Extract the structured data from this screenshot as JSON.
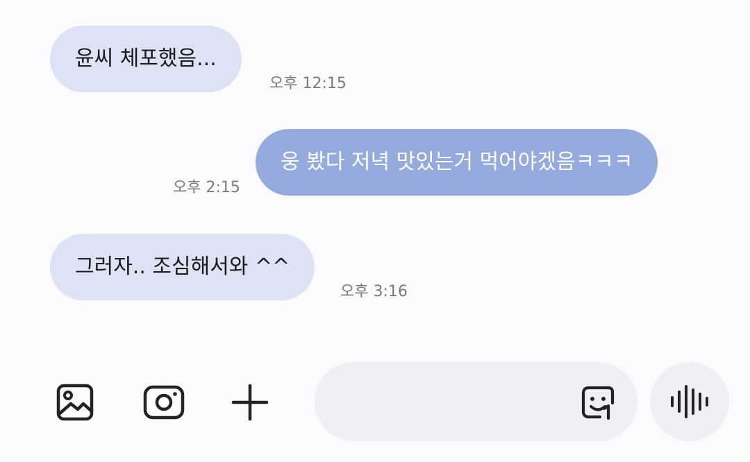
{
  "messages": [
    {
      "direction": "incoming",
      "text": "윤씨 체포했음...",
      "time": "오후 12:15"
    },
    {
      "direction": "outgoing",
      "text": "웅 봤다 저녁 맛있는거 먹어야겠음ㅋㅋㅋ",
      "time": "오후 2:15"
    },
    {
      "direction": "incoming",
      "text": "그러자.. 조심해서와  ^^",
      "time": "오후 3:16"
    }
  ],
  "composer": {
    "gallery_icon": "image-gallery-icon",
    "camera_icon": "camera-icon",
    "plus_icon": "plus-icon",
    "emoji_icon": "emoji-sticker-icon",
    "voice_icon": "voice-waveform-icon",
    "input_value": "",
    "input_placeholder": ""
  },
  "colors": {
    "incoming_bubble": "#dde3f4",
    "outgoing_bubble": "#95abde",
    "background": "#fbfbfd",
    "input_background": "#eff0f4"
  }
}
